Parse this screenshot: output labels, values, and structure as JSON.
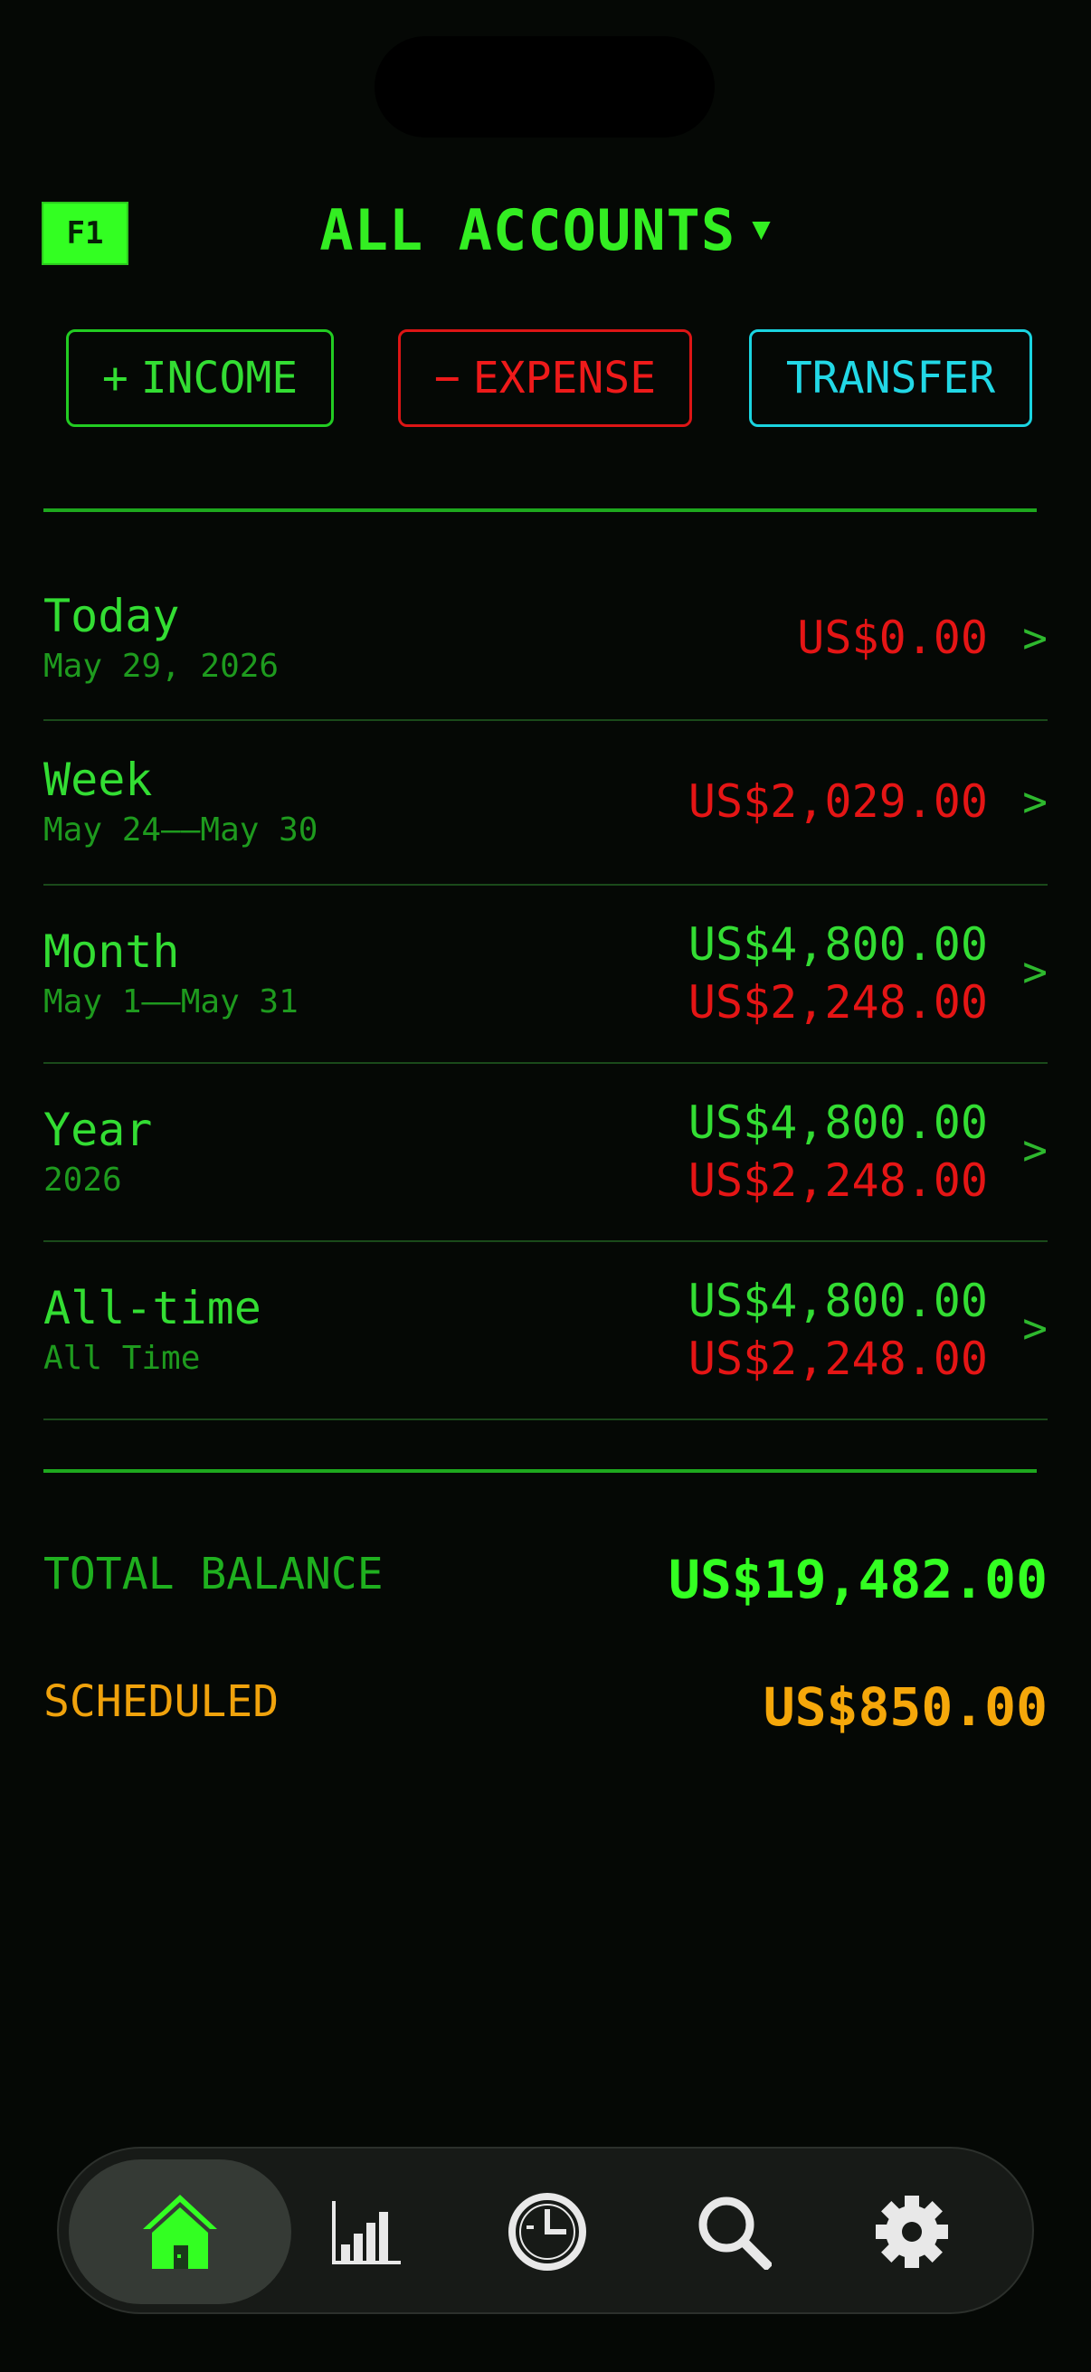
{
  "header": {
    "badge": "F1",
    "title": "ALL ACCOUNTS",
    "caret": "▼"
  },
  "actions": {
    "income": {
      "symbol": "+",
      "label": "INCOME",
      "color": "#33dd33"
    },
    "expense": {
      "symbol": "−",
      "label": "EXPENSE",
      "color": "#e51515"
    },
    "transfer": {
      "label": "TRANSFER",
      "color": "#22d8e6"
    }
  },
  "periods": [
    {
      "label": "Today",
      "sub": "May 29, 2026",
      "income": "",
      "expense": "US$0.00"
    },
    {
      "label": "Week",
      "sub": "May 24——May 30",
      "income": "",
      "expense": "US$2,029.00"
    },
    {
      "label": "Month",
      "sub": "May 1——May 31",
      "income": "US$4,800.00",
      "expense": "US$2,248.00"
    },
    {
      "label": "Year",
      "sub": "2026",
      "income": "US$4,800.00",
      "expense": "US$2,248.00"
    },
    {
      "label": "All-time",
      "sub": "All Time",
      "income": "US$4,800.00",
      "expense": "US$2,248.00"
    }
  ],
  "chevron": ">",
  "summary": {
    "total_label": "TOTAL BALANCE",
    "total_value": "US$19,482.00",
    "total_color": "#33ff22",
    "scheduled_label": "SCHEDULED",
    "scheduled_value": "US$850.00",
    "scheduled_color": "#f5a70a"
  },
  "tabbar": {
    "items": [
      {
        "icon": "home-icon",
        "active": true
      },
      {
        "icon": "bar-chart-icon",
        "active": false
      },
      {
        "icon": "clock-icon",
        "active": false
      },
      {
        "icon": "search-icon",
        "active": false
      },
      {
        "icon": "gear-icon",
        "active": false
      }
    ]
  }
}
